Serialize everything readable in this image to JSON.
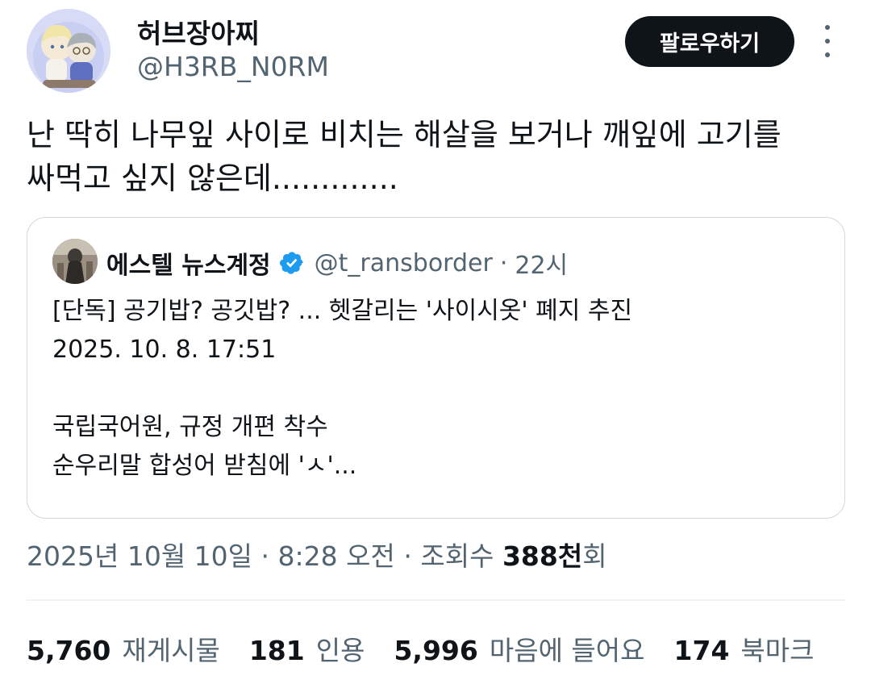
{
  "author": {
    "display_name": "허브장아찌",
    "handle": "@H3RB_N0RM"
  },
  "follow_button_label": "팔로우하기",
  "more_icon": "more-vertical-icon",
  "tweet": {
    "lines": [
      "난 딱히 나무잎 사이로 비치는 해살을 보거나 깨잎에 고기를",
      "싸먹고 싶지 않은데............."
    ]
  },
  "quote": {
    "display_name": "에스텔 뉴스계정",
    "verified_icon": "verified-badge-icon",
    "handle": "@t_ransborder",
    "separator": "·",
    "time": "22시",
    "lines": [
      "[단독] 공기밥? 공깃밥? ... 헷갈리는 '사이시옷' 폐지 추진",
      "2025. 10. 8. 17:51",
      "",
      "국립국어원, 규정 개편 착수",
      "순우리말 합성어 받침에 'ㅅ'..."
    ]
  },
  "meta": {
    "date": "2025년 10월 10일",
    "sep1": "·",
    "time": "8:28 오전",
    "sep2": "·",
    "views_label": "조회수",
    "views_count": "388천",
    "views_suffix": "회"
  },
  "stats": {
    "reposts": {
      "count": "5,760",
      "label": "재게시물"
    },
    "quotes": {
      "count": "181",
      "label": "인용"
    },
    "likes": {
      "count": "5,996",
      "label": "마음에 들어요"
    },
    "bookmarks": {
      "count": "174",
      "label": "북마크"
    }
  },
  "colors": {
    "text_primary": "#0f1419",
    "text_secondary": "#536471",
    "border": "#cfd9de",
    "verified_blue": "#1d9bf0",
    "follow_bg": "#0f1419"
  }
}
